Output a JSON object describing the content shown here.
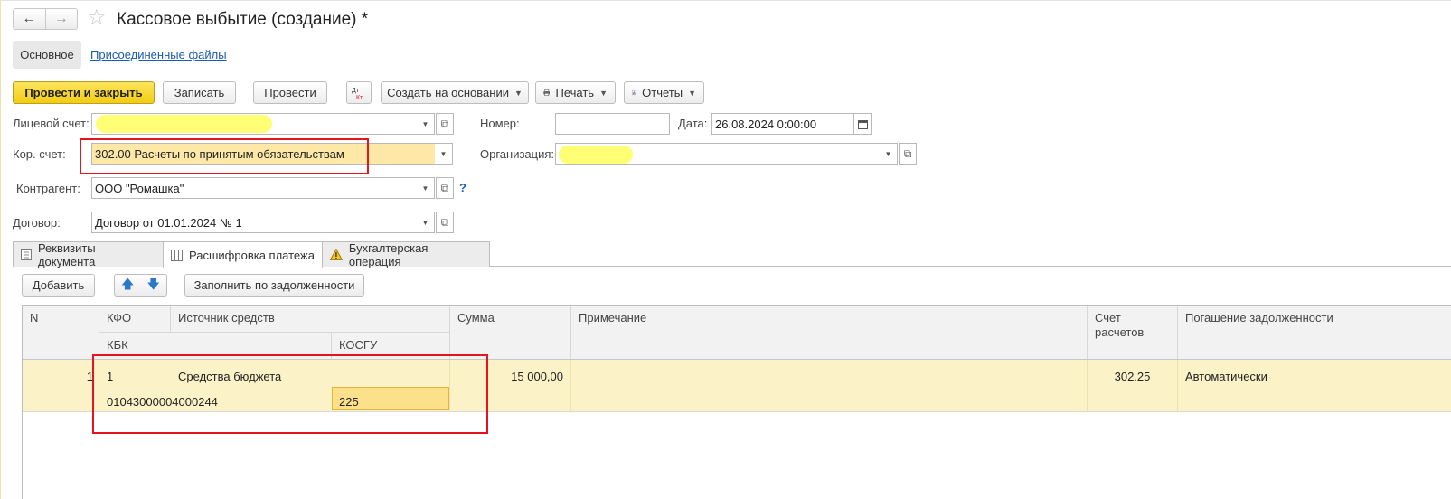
{
  "window": {
    "title": "Кассовое выбытие (создание) *"
  },
  "sections": {
    "main": "Основное",
    "attached": "Присоединенные файлы"
  },
  "toolbar": {
    "post_close": "Провести и закрыть",
    "save": "Записать",
    "post": "Провести",
    "create_based": "Создать на основании",
    "print": "Печать",
    "reports": "Отчеты"
  },
  "form": {
    "account_label": "Лицевой счет:",
    "account_value": "",
    "number_label": "Номер:",
    "number_value": "",
    "date_label": "Дата:",
    "date_value": "26.08.2024  0:00:00",
    "cor_label": "Кор. счет:",
    "cor_value": "302.00 Расчеты по принятым обязательствам",
    "org_label": "Организация:",
    "org_value": "",
    "contractor_label": "Контрагент:",
    "contractor_value": "ООО \"Ромашка\"",
    "contract_label": "Договор:",
    "contract_value": "Договор от 01.01.2024 № 1",
    "help": "?"
  },
  "tabs": [
    {
      "label": "Реквизиты документа",
      "icon": "document-icon"
    },
    {
      "label": "Расшифровка платежа",
      "icon": "table-icon",
      "active": true
    },
    {
      "label": "Бухгалтерская операция",
      "icon": "warning-icon"
    }
  ],
  "grid_toolbar": {
    "add": "Добавить",
    "fill": "Заполнить по задолженности"
  },
  "grid": {
    "headers": {
      "n": "N",
      "kfo": "КФО",
      "source": "Источник средств",
      "kbk": "КБК",
      "kosgu": "КОСГУ",
      "sum": "Сумма",
      "note": "Примечание",
      "account": "Счет расчетов",
      "repay": "Погашение задолженности"
    },
    "rows": [
      {
        "n": "1",
        "kfo": "1",
        "source": "Средства бюджета",
        "kbk": "01043000004000244",
        "kosgu": "225",
        "sum": "15 000,00",
        "note": "",
        "account": "302.25",
        "repay": "Автоматически"
      }
    ]
  },
  "colors": {
    "primary_button": "#f3cc12",
    "highlight_row": "#fcf2c8",
    "annotation": "#e8141d",
    "link": "#1a5dab"
  }
}
